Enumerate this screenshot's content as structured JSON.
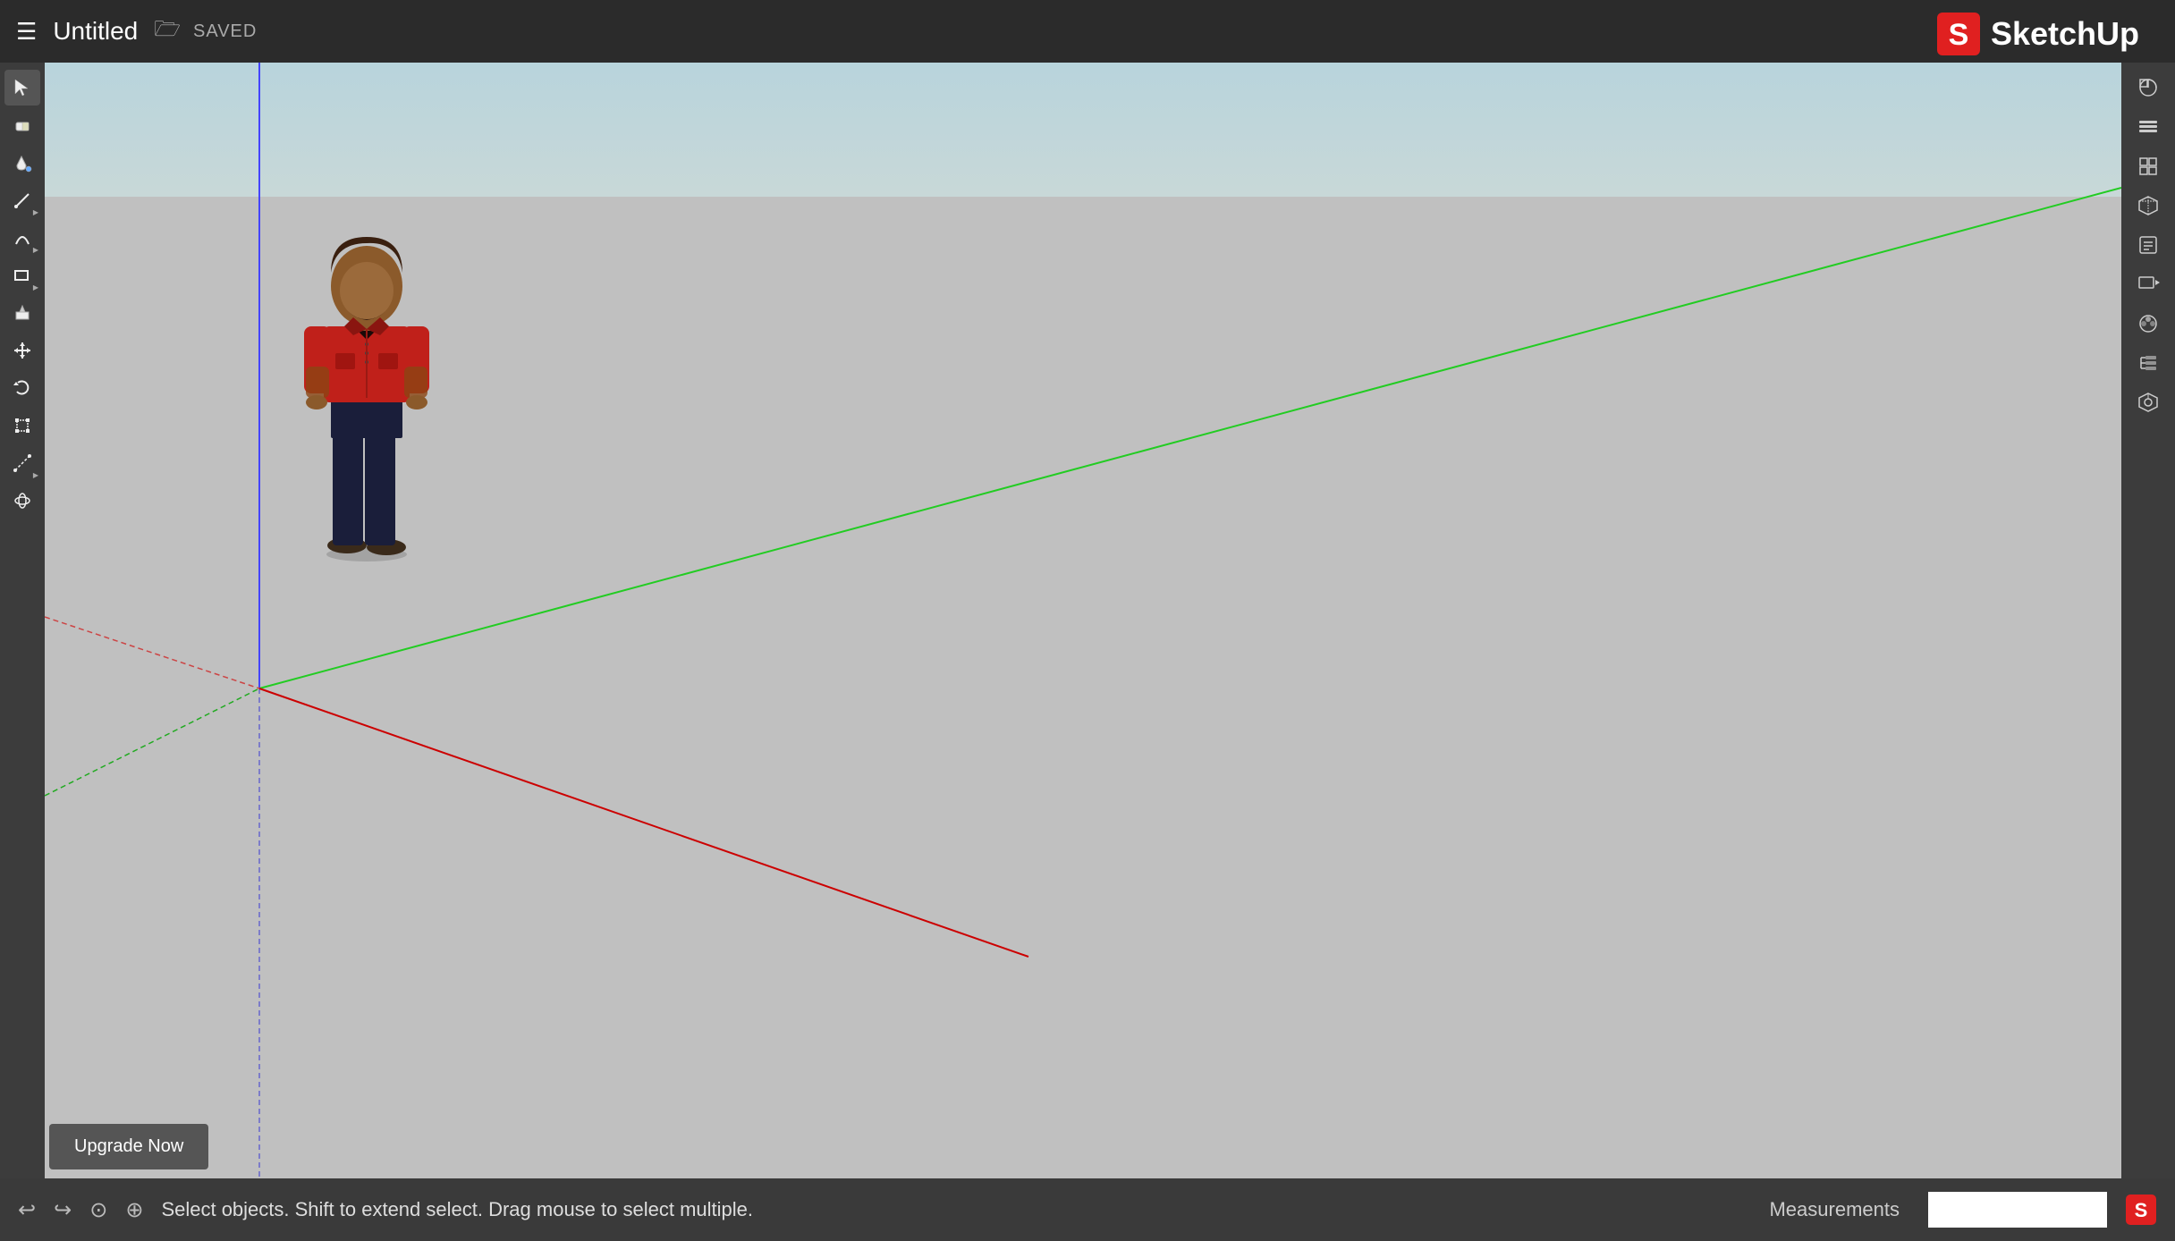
{
  "app": {
    "title": "Untitled",
    "saved_status": "SAVED",
    "logo_text": "SketchUp"
  },
  "toolbar_left": {
    "tools": [
      {
        "name": "select",
        "icon": "↖",
        "label": "Select",
        "active": true,
        "has_arrow": false
      },
      {
        "name": "eraser",
        "icon": "◻",
        "label": "Eraser",
        "active": false,
        "has_arrow": false
      },
      {
        "name": "paint-bucket",
        "icon": "⊕",
        "label": "Paint Bucket",
        "active": false,
        "has_arrow": false
      },
      {
        "name": "pencil",
        "icon": "✏",
        "label": "Line",
        "active": false,
        "has_arrow": true
      },
      {
        "name": "arc",
        "icon": "⌒",
        "label": "Arc",
        "active": false,
        "has_arrow": true
      },
      {
        "name": "shapes",
        "icon": "▱",
        "label": "Shapes",
        "active": false,
        "has_arrow": true
      },
      {
        "name": "push-pull",
        "icon": "⊡",
        "label": "Push Pull",
        "active": false,
        "has_arrow": false
      },
      {
        "name": "move",
        "icon": "✛",
        "label": "Move",
        "active": false,
        "has_arrow": false
      },
      {
        "name": "rotate",
        "icon": "↻",
        "label": "Rotate",
        "active": false,
        "has_arrow": false
      },
      {
        "name": "scale",
        "icon": "⊞",
        "label": "Scale",
        "active": false,
        "has_arrow": false
      },
      {
        "name": "tape-measure",
        "icon": "⊸",
        "label": "Tape Measure",
        "active": false,
        "has_arrow": false
      },
      {
        "name": "orbit",
        "icon": "⊛",
        "label": "Orbit",
        "active": false,
        "has_arrow": false
      }
    ]
  },
  "toolbar_right": {
    "tools": [
      {
        "name": "styles",
        "label": "Styles"
      },
      {
        "name": "layers",
        "label": "Layers"
      },
      {
        "name": "components",
        "label": "Components"
      },
      {
        "name": "3d-warehouse",
        "label": "3D Warehouse"
      },
      {
        "name": "entity-info",
        "label": "Entity Info"
      },
      {
        "name": "scenes",
        "label": "Scenes"
      },
      {
        "name": "materials",
        "label": "Materials"
      },
      {
        "name": "outliner",
        "label": "Outliner"
      },
      {
        "name": "extension-manager",
        "label": "Extension Manager"
      }
    ]
  },
  "status_bar": {
    "status_text": "Select objects. Shift to extend select. Drag mouse to select multiple.",
    "measurements_label": "Measurements",
    "back_icon": "←",
    "forward_icon": "→",
    "help_icon": "?",
    "location_icon": "⊕"
  },
  "upgrade_button": {
    "label": "Upgrade Now"
  },
  "viewport": {
    "axis_colors": {
      "green": "#22cc22",
      "red": "#cc0000",
      "blue": "#4444ff",
      "green_dotted": "#22aa22",
      "red_dotted": "#cc5555"
    }
  }
}
